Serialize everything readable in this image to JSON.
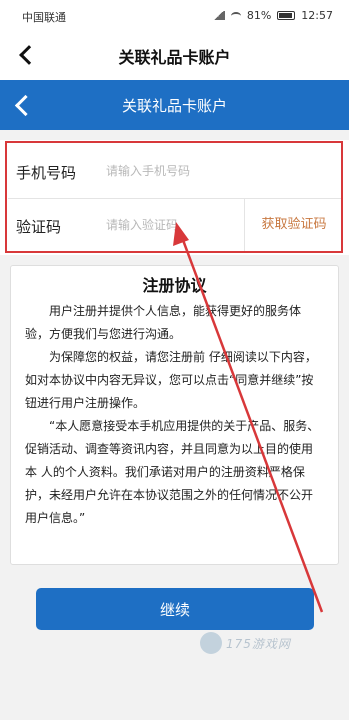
{
  "status_bar": {
    "carrier": "中国联通",
    "battery": "81%",
    "time": "12:57"
  },
  "top_nav": {
    "title": "关联礼品卡账户"
  },
  "blue_nav": {
    "title": "关联礼品卡账户"
  },
  "form": {
    "phone_label": "手机号码",
    "phone_placeholder": "请输入手机号码",
    "code_label": "验证码",
    "code_placeholder": "请输入验证码",
    "get_code_label": "获取验证码"
  },
  "agreement": {
    "title": "注册协议",
    "paragraphs": [
      "用户注册并提供个人信息，能获得更好的服务体验，方便我们与您进行沟通。",
      "为保障您的权益，请您注册前 仔细阅读以下内容，如对本协议中内容无异议，您可以点击“同意并继续”按钮进行用户注册操作。",
      "“本人愿意接受本手机应用提供的关于产品、服务、促销活动、调查等资讯内容，并且同意为以上目的使用本 人的个人资料。我们承诺对用户的注册资料严格保护，未经用户允许在本协议范围之外的任何情况不公开用户信息。”"
    ]
  },
  "continue_label": "继续",
  "watermark": "175游戏网",
  "colors": {
    "brand_blue": "#1e6fc4",
    "highlight_red": "#d8383a",
    "code_button": "#c87840"
  }
}
